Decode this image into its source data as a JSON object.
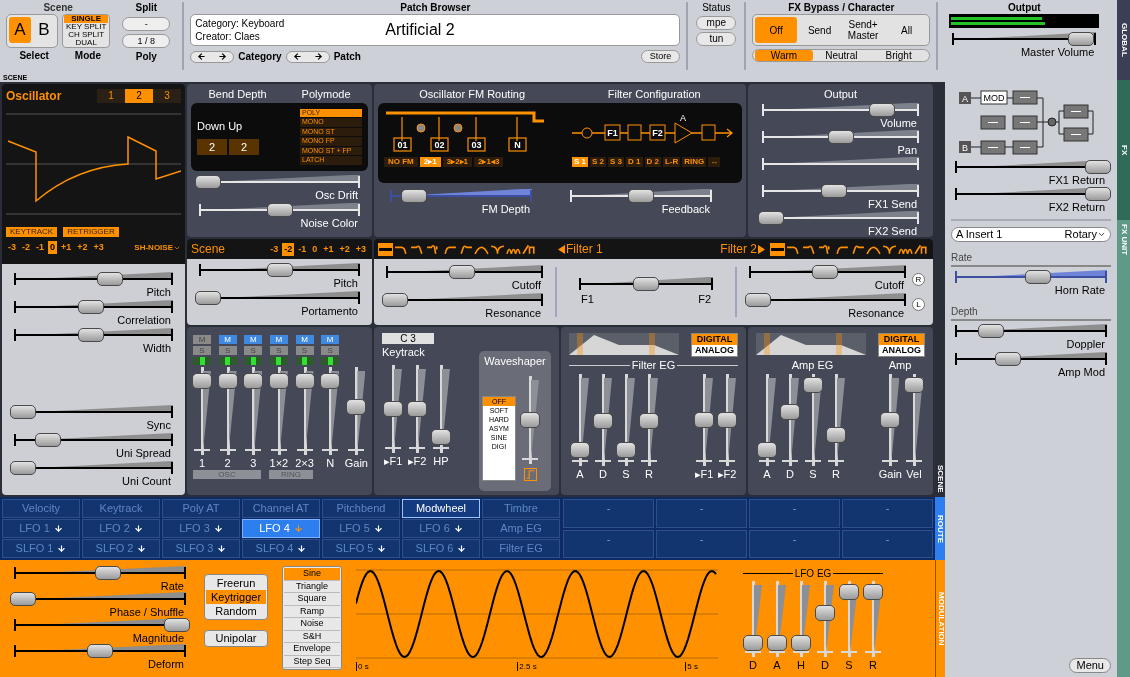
{
  "top": {
    "scene": {
      "title": "Scene",
      "options": [
        {
          "label": "A",
          "selected": true
        },
        {
          "label": "B",
          "selected": false
        }
      ],
      "caption": "Select"
    },
    "mode": {
      "options": [
        {
          "label": "SINGLE",
          "selected": true
        },
        {
          "label": "KEY SPLIT",
          "selected": false
        },
        {
          "label": "CH SPLIT",
          "selected": false
        },
        {
          "label": "DUAL",
          "selected": false
        }
      ],
      "caption": "Mode"
    },
    "split": {
      "title": "Split",
      "value": "-"
    },
    "poly": {
      "value": "1 / 8",
      "caption": "Poly"
    },
    "patch_browser": {
      "title": "Patch Browser",
      "category": "Category: Keyboard",
      "creator": "Creator: Claes",
      "patch_name": "Artificial 2",
      "category_nav": "Category",
      "patch_nav": "Patch",
      "store": "Store"
    },
    "status": {
      "title": "Status",
      "buttons": [
        "mpe",
        "tun"
      ]
    },
    "fx_bypass": {
      "title": "FX Bypass / Character",
      "modes": [
        {
          "label": "Off",
          "selected": true
        },
        {
          "label": "Send",
          "selected": false
        },
        {
          "label": "Send+ Master",
          "selected": false
        },
        {
          "label": "All",
          "selected": false
        }
      ],
      "character": [
        {
          "label": "Warm",
          "selected": true
        },
        {
          "label": "Neutral",
          "selected": false
        },
        {
          "label": "Bright",
          "selected": false
        }
      ]
    },
    "output": {
      "title": "Output",
      "meter": [
        {
          "level": 0.62
        },
        {
          "level": 0.64
        }
      ],
      "master_volume": {
        "label": "Master Volume",
        "level": 0.95
      }
    }
  },
  "section_label": "SCENE",
  "side_tabs": {
    "global": "GLOBAL",
    "fx": "FX",
    "fx_unit": "FX UNIT",
    "scene": "SCENE",
    "route": "ROUTE",
    "modulation": "MODULATION"
  },
  "oscillator": {
    "title": "Oscillator",
    "numbers": [
      {
        "label": "1",
        "selected": false
      },
      {
        "label": "2",
        "selected": true
      },
      {
        "label": "3",
        "selected": false
      }
    ],
    "toggles": [
      "KEYTRACK",
      "RETRIGGER"
    ],
    "octave": [
      {
        "label": "-3",
        "selected": false
      },
      {
        "label": "-2",
        "selected": false
      },
      {
        "label": "-1",
        "selected": false
      },
      {
        "label": "0",
        "selected": true
      },
      {
        "label": "+1",
        "selected": false
      },
      {
        "label": "+2",
        "selected": false
      },
      {
        "label": "+3",
        "selected": false
      }
    ],
    "type": "SH-NOISE",
    "sliders_top": [
      {
        "label": "Pitch",
        "level": 0.62
      },
      {
        "label": "Correlation",
        "level": 0.48
      },
      {
        "label": "Width",
        "level": 0.48
      }
    ],
    "sliders_bottom": [
      {
        "label": "Sync",
        "level": 0
      },
      {
        "label": "Uni Spread",
        "level": 0.18
      },
      {
        "label": "Uni Count",
        "level": 0
      }
    ]
  },
  "bend": {
    "title": "Bend Depth",
    "polymode_title": "Polymode",
    "label": "Down Up",
    "down": "2",
    "up": "2",
    "polymodes": [
      {
        "label": "POLY",
        "selected": true
      },
      {
        "label": "MONO",
        "selected": false
      },
      {
        "label": "MONO ST",
        "selected": false
      },
      {
        "label": "MONO FP",
        "selected": false
      },
      {
        "label": "MONO ST + FP",
        "selected": false
      },
      {
        "label": "LATCH",
        "selected": false
      }
    ],
    "sliders": [
      {
        "label": "Osc Drift",
        "level": 0
      },
      {
        "label": "Noise Color",
        "level": 0.5
      }
    ]
  },
  "fm": {
    "title": "Oscillator FM Routing",
    "filter_title": "Filter Configuration",
    "osc_boxes": [
      "01",
      "02",
      "03",
      "N"
    ],
    "filter_blocks": [
      "F1",
      "F2"
    ],
    "amp_label": "A",
    "fm_modes": [
      {
        "label": "NO FM",
        "selected": false
      },
      {
        "label": "2▸1",
        "selected": true
      },
      {
        "label": "3▸2▸1",
        "selected": false
      },
      {
        "label": "2▸1◂3",
        "selected": false
      }
    ],
    "filter_modes": [
      {
        "label": "S 1",
        "selected": true
      },
      {
        "label": "S 2",
        "selected": false
      },
      {
        "label": "S 3",
        "selected": false
      },
      {
        "label": "D 1",
        "selected": false
      },
      {
        "label": "D 2",
        "selected": false
      },
      {
        "label": "L-R",
        "selected": false
      },
      {
        "label": "RING",
        "selected": false
      },
      {
        "label": "↔",
        "selected": false
      }
    ],
    "sliders": [
      {
        "label": "FM Depth",
        "level": 0.12
      },
      {
        "label": "Feedback",
        "level": 0.5
      }
    ]
  },
  "output": {
    "title": "Output",
    "sliders": [
      {
        "kind": "slider",
        "label": "Volume",
        "level": 0.8
      },
      {
        "kind": "slider",
        "label": "Pan",
        "level": 0.5
      },
      {
        "kind": "track"
      },
      {
        "kind": "slider",
        "label": "FX1 Send",
        "level": 0.45
      },
      {
        "kind": "slider",
        "label": "FX2 Send",
        "level": 0
      }
    ]
  },
  "scene": {
    "title": "Scene",
    "octave": [
      {
        "label": "-3",
        "selected": false
      },
      {
        "label": "-2",
        "selected": true
      },
      {
        "label": "-1",
        "selected": false
      },
      {
        "label": "0",
        "selected": false
      },
      {
        "label": "+1",
        "selected": false
      },
      {
        "label": "+2",
        "selected": false
      },
      {
        "label": "+3",
        "selected": false
      }
    ],
    "sliders": [
      {
        "label": "Pitch",
        "level": 0.5
      },
      {
        "label": "Portamento",
        "level": 0
      }
    ]
  },
  "mixer": {
    "channels": [
      {
        "label": "1",
        "mute": {
          "label": "M",
          "on": false
        },
        "solo": {
          "label": "S",
          "on": false
        },
        "level": 0.92
      },
      {
        "label": "2",
        "mute": {
          "label": "M",
          "on": true
        },
        "solo": {
          "label": "S",
          "on": false
        },
        "level": 0.92
      },
      {
        "label": "3",
        "mute": {
          "label": "M",
          "on": true
        },
        "solo": {
          "label": "S",
          "on": false
        },
        "level": 0.92
      },
      {
        "label": "1×2",
        "mute": {
          "label": "M",
          "on": true
        },
        "solo": {
          "label": "S",
          "on": false
        },
        "level": 0.92
      },
      {
        "label": "2×3",
        "mute": {
          "label": "M",
          "on": true
        },
        "solo": {
          "label": "S",
          "on": false
        },
        "level": 0.92
      },
      {
        "label": "N",
        "mute": {
          "label": "M",
          "on": true
        },
        "solo": {
          "label": "S",
          "on": false
        },
        "level": 0.92
      }
    ],
    "gain": {
      "label": "Gain",
      "level": 0.55
    },
    "groups": [
      "OSC",
      "RING"
    ]
  },
  "filters": {
    "filter1": {
      "title": "Filter 1",
      "types": [
        {
          "kind": "off",
          "selected": true
        },
        {
          "kind": "lp12",
          "selected": false
        },
        {
          "kind": "lp24",
          "selected": false
        },
        {
          "kind": "ladder",
          "selected": false
        },
        {
          "kind": "hp12",
          "selected": false
        },
        {
          "kind": "hp24",
          "selected": false
        },
        {
          "kind": "bp",
          "selected": false
        },
        {
          "kind": "notch",
          "selected": false
        },
        {
          "kind": "comb",
          "selected": false
        },
        {
          "kind": "sh",
          "selected": false
        }
      ],
      "sliders": [
        {
          "label": "Cutoff",
          "level": 0.48
        },
        {
          "label": "Resonance",
          "level": 0
        }
      ]
    },
    "balance": {
      "left": "F1",
      "right": "F2",
      "level": 0.5
    },
    "filter2": {
      "title": "Filter 2",
      "types": [
        {
          "kind": "off",
          "selected": true
        },
        {
          "kind": "lp12",
          "selected": false
        },
        {
          "kind": "lp24",
          "selected": false
        },
        {
          "kind": "ladder",
          "selected": false
        },
        {
          "kind": "hp12",
          "selected": false
        },
        {
          "kind": "hp24",
          "selected": false
        },
        {
          "kind": "bp",
          "selected": false
        },
        {
          "kind": "notch",
          "selected": false
        },
        {
          "kind": "comb",
          "selected": false
        },
        {
          "kind": "sh",
          "selected": false
        }
      ],
      "sliders": [
        {
          "label": "Cutoff",
          "level": 0.48
        },
        {
          "label": "Resonance",
          "level": 0
        }
      ],
      "side_marks": [
        "R",
        "L"
      ]
    }
  },
  "keytrack": {
    "note": "C 3",
    "title": "Keytrack",
    "sliders": [
      {
        "label": "▸F1",
        "level": 0.5
      },
      {
        "label": "▸F2",
        "level": 0.5
      },
      {
        "label": "HP",
        "level": 0.1
      }
    ]
  },
  "waveshaper": {
    "title": "Waveshaper",
    "options": [
      {
        "label": "OFF",
        "selected": true
      },
      {
        "label": "SOFT",
        "selected": false
      },
      {
        "label": "HARD",
        "selected": false
      },
      {
        "label": "ASYM",
        "selected": false
      },
      {
        "label": "SINE",
        "selected": false
      },
      {
        "label": "DIGI",
        "selected": false
      }
    ],
    "level": 0.5
  },
  "filter_eg": {
    "title": "Filter EG",
    "modes": [
      {
        "label": "DIGITAL",
        "selected": true
      },
      {
        "label": "ANALOG",
        "selected": false
      }
    ],
    "sliders": [
      {
        "label": "A",
        "level": 0.1
      },
      {
        "label": "D",
        "level": 0.48
      },
      {
        "label": "S",
        "level": 0.1
      },
      {
        "label": "R",
        "level": 0.48
      }
    ],
    "sends": [
      {
        "label": "▸F1",
        "level": 0.5
      },
      {
        "label": "▸F2",
        "level": 0.5
      }
    ]
  },
  "amp_eg": {
    "title": "Amp EG",
    "modes": [
      {
        "label": "DIGITAL",
        "selected": true
      },
      {
        "label": "ANALOG",
        "selected": false
      }
    ],
    "sliders": [
      {
        "label": "A",
        "level": 0.1
      },
      {
        "label": "D",
        "level": 0.6
      },
      {
        "label": "S",
        "level": 0.95
      },
      {
        "label": "R",
        "level": 0.3
      }
    ],
    "amp_title": "Amp",
    "amp_sliders": [
      {
        "label": "Gain",
        "level": 0.5
      },
      {
        "label": "Vel",
        "level": 0.95
      }
    ]
  },
  "route": {
    "rows": [
      [
        {
          "kind": "source",
          "label": "Velocity",
          "selected": false
        },
        {
          "kind": "source",
          "label": "Keytrack",
          "selected": false
        },
        {
          "kind": "source",
          "label": "Poly AT",
          "selected": false
        },
        {
          "kind": "source",
          "label": "Channel AT",
          "selected": false
        },
        {
          "kind": "source",
          "label": "Pitchbend",
          "selected": false
        },
        {
          "kind": "source",
          "label": "Modwheel",
          "selected": true
        },
        {
          "kind": "source",
          "label": "Timbre",
          "selected": false
        }
      ],
      [
        {
          "kind": "lfo",
          "label": "LFO 1",
          "selected": false
        },
        {
          "kind": "lfo",
          "label": "LFO 2",
          "selected": false
        },
        {
          "kind": "lfo",
          "label": "LFO 3",
          "selected": false
        },
        {
          "kind": "lfo",
          "label": "LFO 4",
          "selected": true
        },
        {
          "kind": "lfo",
          "label": "LFO 5",
          "selected": false
        },
        {
          "kind": "lfo",
          "label": "LFO 6",
          "selected": false
        },
        {
          "kind": "source",
          "label": "Amp EG",
          "selected": false
        }
      ],
      [
        {
          "kind": "lfo",
          "label": "SLFO 1",
          "selected": false
        },
        {
          "kind": "lfo",
          "label": "SLFO 2",
          "selected": false
        },
        {
          "kind": "lfo",
          "label": "SLFO 3",
          "selected": false
        },
        {
          "kind": "lfo",
          "label": "SLFO 4",
          "selected": false
        },
        {
          "kind": "lfo",
          "label": "SLFO 5",
          "selected": false
        },
        {
          "kind": "lfo",
          "label": "SLFO 6",
          "selected": false
        },
        {
          "kind": "source",
          "label": "Filter EG",
          "selected": false
        }
      ]
    ],
    "slots": [
      [
        "-",
        "-",
        "-",
        "-"
      ],
      [
        "-",
        "-",
        "-",
        "-"
      ]
    ]
  },
  "modulation": {
    "sliders": [
      {
        "label": "Rate",
        "level": 0.55
      },
      {
        "label": "Phase / Shuffle",
        "level": 0
      },
      {
        "label": "Magnitude",
        "level": 1
      },
      {
        "label": "Deform",
        "level": 0.5
      }
    ],
    "triggers": [
      {
        "label": "Freerun",
        "selected": false
      },
      {
        "label": "Keytrigger",
        "selected": true
      },
      {
        "label": "Random",
        "selected": false
      }
    ],
    "unipolar": {
      "label": "Unipolar",
      "on": false
    },
    "shapes": [
      {
        "label": "Sine",
        "selected": true
      },
      {
        "label": "Triangle",
        "selected": false
      },
      {
        "label": "Square",
        "selected": false
      },
      {
        "label": "Ramp",
        "selected": false
      },
      {
        "label": "Noise",
        "selected": false
      },
      {
        "label": "S&H",
        "selected": false
      },
      {
        "label": "Envelope",
        "selected": false
      },
      {
        "label": "Step Seq",
        "selected": false
      }
    ],
    "time_ticks": [
      "0 s",
      "2.5 s",
      "5 s"
    ],
    "eg": {
      "title": "LFO EG",
      "sliders": [
        {
          "label": "D",
          "level": 0.1
        },
        {
          "label": "A",
          "level": 0.1
        },
        {
          "label": "H",
          "level": 0.1
        },
        {
          "label": "D",
          "level": 0.6
        },
        {
          "label": "S",
          "level": 0.95
        },
        {
          "label": "R",
          "level": 0.95
        }
      ]
    }
  },
  "fx": {
    "routing": {
      "a": "A",
      "mod": "MOD",
      "b": "B"
    },
    "returns": [
      {
        "label": "FX1 Return",
        "level": 1
      },
      {
        "label": "FX2 Return",
        "level": 1
      }
    ],
    "insert": {
      "slot": "A Insert 1",
      "type": "Rotary"
    },
    "groups": [
      {
        "title": "Rate",
        "sliders": [
          {
            "label": "Horn Rate",
            "level": 0.55
          }
        ]
      },
      {
        "title": "Depth",
        "sliders": [
          {
            "label": "Doppler",
            "level": 0.2
          },
          {
            "label": "Amp Mod",
            "level": 0.33
          }
        ]
      }
    ],
    "menu": "Menu"
  }
}
